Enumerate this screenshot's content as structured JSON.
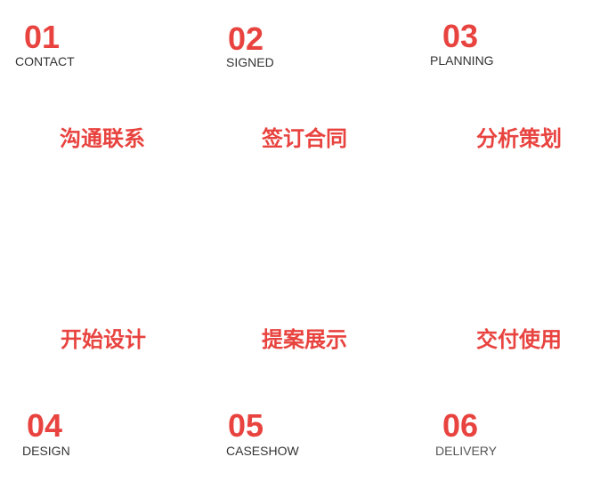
{
  "colors": {
    "accent": "#e8433f",
    "text": "#333333"
  },
  "steps": [
    {
      "number": "01",
      "en": "CONTACT",
      "cn": "沟通联系"
    },
    {
      "number": "02",
      "en": "SIGNED",
      "cn": "签订合同"
    },
    {
      "number": "03",
      "en": "PLANNING",
      "cn": "分析策划"
    },
    {
      "number": "04",
      "en": "DESIGN",
      "cn": "开始设计"
    },
    {
      "number": "05",
      "en": "CASESHOW",
      "cn": "提案展示"
    },
    {
      "number": "06",
      "en": "DELIVERY",
      "cn": "交付使用"
    }
  ]
}
